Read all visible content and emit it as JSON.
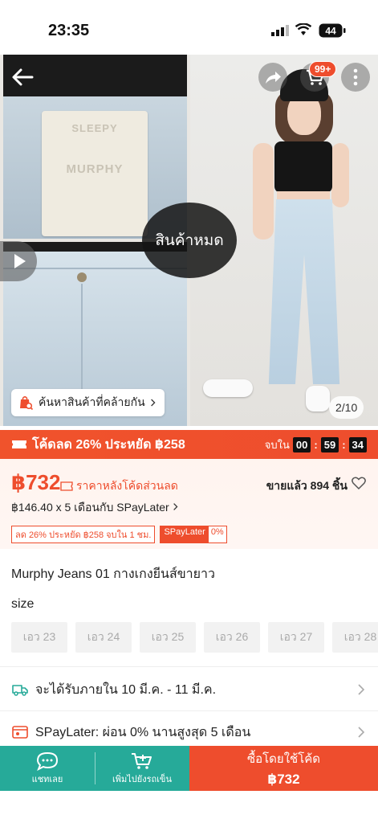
{
  "status_bar": {
    "time": "23:35",
    "battery": "44"
  },
  "gallery": {
    "patch_text_1": "SLEEPY",
    "patch_text_2": "MURPHY",
    "soldout_label": "สินค้าหมด",
    "similar_label": "ค้นหาสินค้าที่คล้ายกัน",
    "image_counter": "2/10",
    "cart_badge": "99+"
  },
  "promo": {
    "label": "โค้ดลด 26% ประหยัด ฿258",
    "ends_label": "จบใน",
    "hh": "00",
    "mm": "59",
    "ss": "34"
  },
  "price": {
    "value": "฿732",
    "note": "ราคาหลังโค้ดส่วนลด",
    "sold": "ขายแล้ว 894 ชิ้น",
    "installment": "฿146.40 x 5 เดือนกับ SPayLater",
    "tag_discount": "ลด 26% ประหยัด ฿258 จบใน 1 ชม.",
    "tag_spay_a": "SPayLater",
    "tag_spay_b": "0%"
  },
  "product": {
    "title": "Murphy Jeans 01 กางเกงยีนส์ขายาว",
    "size_label": "size",
    "sizes": [
      "เอว 23",
      "เอว 24",
      "เอว 25",
      "เอว 26",
      "เอว 27",
      "เอว 28"
    ]
  },
  "rows": {
    "delivery": "จะได้รับภายใน 10 มี.ค. - 11 มี.ค.",
    "spaylater": "SPayLater: ผ่อน 0% นานสูงสุด 5 เดือน"
  },
  "bottom": {
    "chat": "แชทเลย",
    "add_cart": "เพิ่มไปยังรถเข็น",
    "buy_line1": "ซื้อโดยใช้โค้ด",
    "buy_line2": "฿732"
  },
  "colors": {
    "brand": "#ee4d2d",
    "secondary": "#26aa99"
  }
}
